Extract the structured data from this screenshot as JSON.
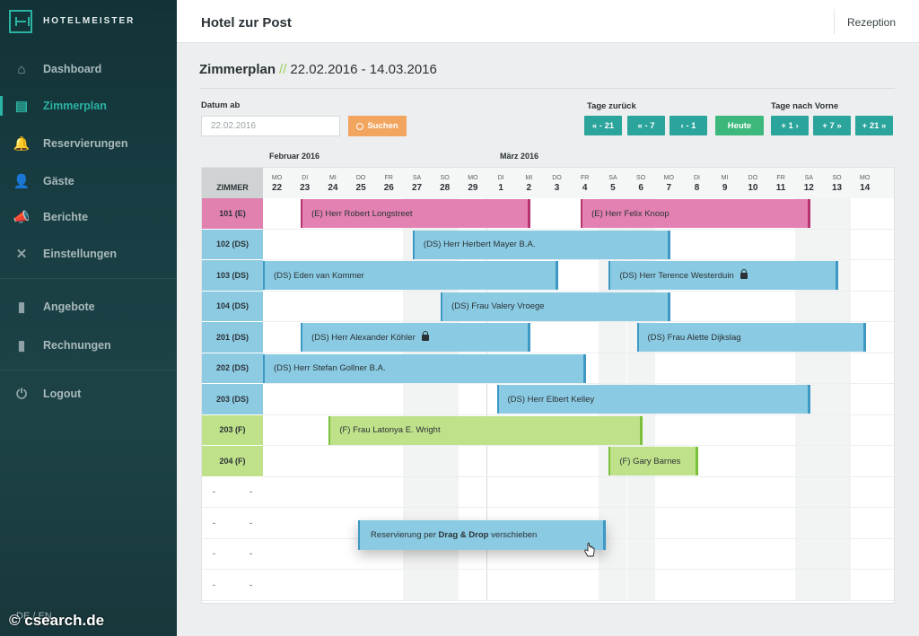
{
  "brand": {
    "name": "HOTELMEISTER"
  },
  "sidebar": {
    "items": [
      {
        "label": "Dashboard",
        "icon": "home-icon",
        "glyph": "⌂"
      },
      {
        "label": "Zimmerplan",
        "icon": "calendar-icon",
        "glyph": "▤",
        "active": true
      },
      {
        "label": "Reservierungen",
        "icon": "bell-icon",
        "glyph": "🔔"
      },
      {
        "label": "Gäste",
        "icon": "user-icon",
        "glyph": "👤"
      },
      {
        "label": "Berichte",
        "icon": "megaphone-icon",
        "glyph": "📣"
      },
      {
        "label": "Einstellungen",
        "icon": "tools-icon",
        "glyph": "✕"
      },
      {
        "label": "Angebote",
        "icon": "document-icon",
        "glyph": "▮"
      },
      {
        "label": "Rechnungen",
        "icon": "document-icon",
        "glyph": "▮"
      },
      {
        "label": "Logout",
        "icon": "power-icon",
        "glyph": "⏻"
      }
    ],
    "language": "DE / EN"
  },
  "header": {
    "hotel": "Hotel zur Post",
    "user_menu": "Rezeption"
  },
  "page": {
    "title": "Zimmerplan",
    "slashes": "//",
    "range": "22.02.2016 - 14.03.2016"
  },
  "search": {
    "label": "Datum ab",
    "value": "22.02.2016",
    "button": "Suchen"
  },
  "navigation": {
    "back_label": "Tage zurück",
    "forward_label": "Tage nach Vorne",
    "buttons": [
      "« - 21",
      "« - 7",
      "‹ - 1",
      "Heute",
      "+ 1 ›",
      "+ 7 »",
      "+ 21 »"
    ]
  },
  "calendar": {
    "room_header": "ZIMMER",
    "months": [
      "Februar 2016",
      "März 2016"
    ],
    "days": [
      {
        "dn": "MO",
        "dd": "22"
      },
      {
        "dn": "DI",
        "dd": "23"
      },
      {
        "dn": "MI",
        "dd": "24"
      },
      {
        "dn": "DO",
        "dd": "25"
      },
      {
        "dn": "FR",
        "dd": "26"
      },
      {
        "dn": "SA",
        "dd": "27"
      },
      {
        "dn": "SO",
        "dd": "28"
      },
      {
        "dn": "MO",
        "dd": "29"
      },
      {
        "dn": "DI",
        "dd": "1"
      },
      {
        "dn": "MI",
        "dd": "2"
      },
      {
        "dn": "DO",
        "dd": "3"
      },
      {
        "dn": "FR",
        "dd": "4"
      },
      {
        "dn": "SA",
        "dd": "5"
      },
      {
        "dn": "SO",
        "dd": "6"
      },
      {
        "dn": "MO",
        "dd": "7"
      },
      {
        "dn": "DI",
        "dd": "8"
      },
      {
        "dn": "MI",
        "dd": "9"
      },
      {
        "dn": "DO",
        "dd": "10"
      },
      {
        "dn": "FR",
        "dd": "11"
      },
      {
        "dn": "SA",
        "dd": "12"
      },
      {
        "dn": "SO",
        "dd": "13"
      },
      {
        "dn": "MO",
        "dd": "14"
      }
    ],
    "rooms": [
      {
        "name": "101 (E)",
        "type": "e"
      },
      {
        "name": "102 (DS)",
        "type": "ds"
      },
      {
        "name": "103 (DS)",
        "type": "ds"
      },
      {
        "name": "104 (DS)",
        "type": "ds"
      },
      {
        "name": "201 (DS)",
        "type": "ds"
      },
      {
        "name": "202 (DS)",
        "type": "ds"
      },
      {
        "name": "203 (DS)",
        "type": "ds"
      },
      {
        "name": "203 (F)",
        "type": "f"
      },
      {
        "name": "204 (F)",
        "type": "f"
      },
      {
        "name": "-",
        "type": "empty"
      },
      {
        "name": "-",
        "type": "empty"
      },
      {
        "name": "-",
        "type": "empty"
      },
      {
        "name": "-",
        "type": "empty"
      }
    ],
    "reservations": [
      {
        "room": 0,
        "type": "e",
        "label": "(E) Herr Robert Longstreet",
        "start": "23.02.2016",
        "end": "02.03.2016",
        "locked": false
      },
      {
        "room": 0,
        "type": "e",
        "label": "(E) Herr Felix Knoop",
        "start": "04.03.2016",
        "end": "12.03.2016",
        "locked": false
      },
      {
        "room": 1,
        "type": "ds",
        "label": "(DS) Herr Herbert Mayer B.A.",
        "start": "27.02.2016",
        "end": "07.03.2016",
        "locked": false
      },
      {
        "room": 2,
        "type": "ds",
        "label": "(DS) Eden van Kommer",
        "start": "22.02.2016",
        "end": "03.03.2016",
        "locked": false
      },
      {
        "room": 2,
        "type": "ds",
        "label": "(DS) Herr Terence Westerduin",
        "start": "05.03.2016",
        "end": "13.03.2016",
        "locked": true
      },
      {
        "room": 3,
        "type": "ds",
        "label": "(DS) Frau Valery Vroege",
        "start": "28.02.2016",
        "end": "07.03.2016",
        "locked": false
      },
      {
        "room": 4,
        "type": "ds",
        "label": "(DS) Herr Alexander Köhler",
        "start": "23.02.2016",
        "end": "02.03.2016",
        "locked": true
      },
      {
        "room": 4,
        "type": "ds",
        "label": "(DS) Frau Alette Dijkslag",
        "start": "06.03.2016",
        "end": "14.03.2016",
        "locked": false
      },
      {
        "room": 5,
        "type": "ds",
        "label": "(DS) Herr Stefan Gollner B.A.",
        "start": "22.02.2016",
        "end": "04.03.2016",
        "locked": false
      },
      {
        "room": 6,
        "type": "ds",
        "label": "(DS) Herr Elbert Kelley",
        "start": "01.03.2016",
        "end": "12.03.2016",
        "locked": false
      },
      {
        "room": 7,
        "type": "f",
        "label": "(F) Frau Latonya E. Wright",
        "start": "24.02.2016",
        "end": "06.03.2016",
        "locked": false
      },
      {
        "room": 8,
        "type": "f",
        "label": "(F) Gary Barnes",
        "start": "05.03.2016",
        "end": "08.03.2016",
        "locked": false
      }
    ],
    "drag_hint": {
      "prefix": "Reservierung per ",
      "bold": "Drag & Drop",
      "suffix": " verschieben"
    }
  },
  "colors": {
    "accent": "#2bb3a3",
    "search": "#f2a55f",
    "today": "#3db87c",
    "single": "#e381b2",
    "double": "#8acae2",
    "family": "#bfe18a"
  },
  "watermark": "© csearch.de"
}
